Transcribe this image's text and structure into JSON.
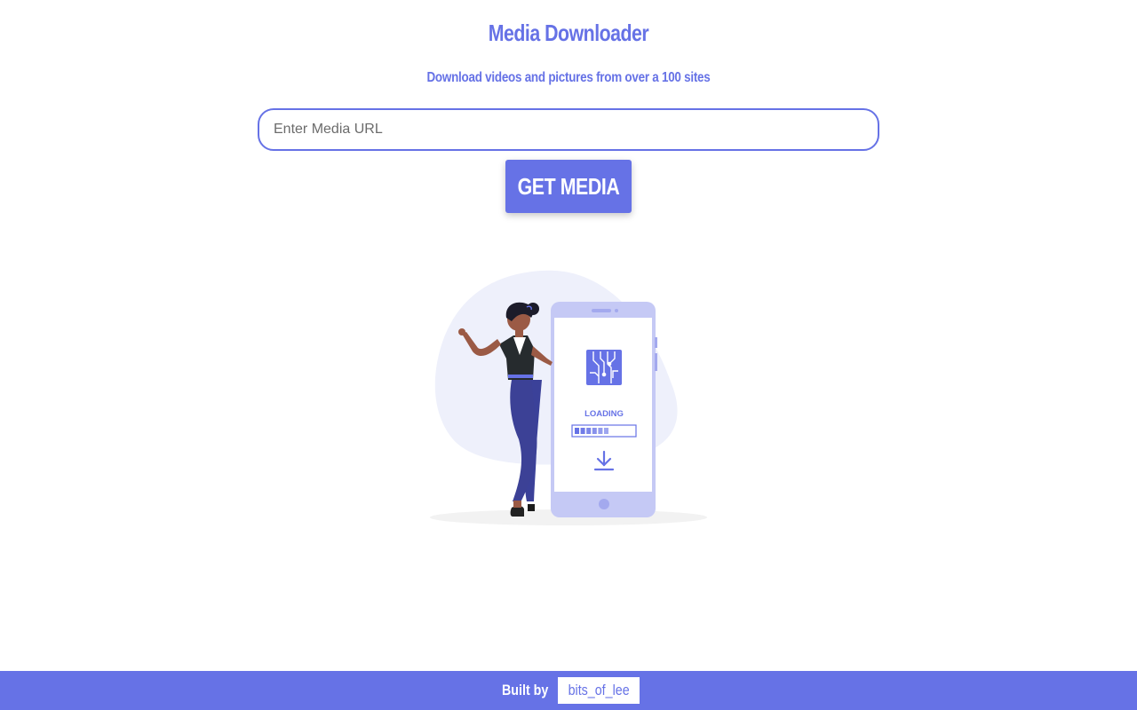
{
  "header": {
    "title": "Media Downloader",
    "subtitle": "Download videos and pictures from over a 100 sites"
  },
  "form": {
    "url_placeholder": "Enter Media URL",
    "url_value": "",
    "submit_label": "GET MEDIA"
  },
  "illustration": {
    "loading_text": "LOADING",
    "progress": 0.6
  },
  "footer": {
    "built_by_text": "Built by",
    "author_link_text": "bits_of_lee"
  },
  "colors": {
    "accent": "#6672e6",
    "blob": "#eef0fb",
    "phone_frame": "#c5c9f5"
  }
}
